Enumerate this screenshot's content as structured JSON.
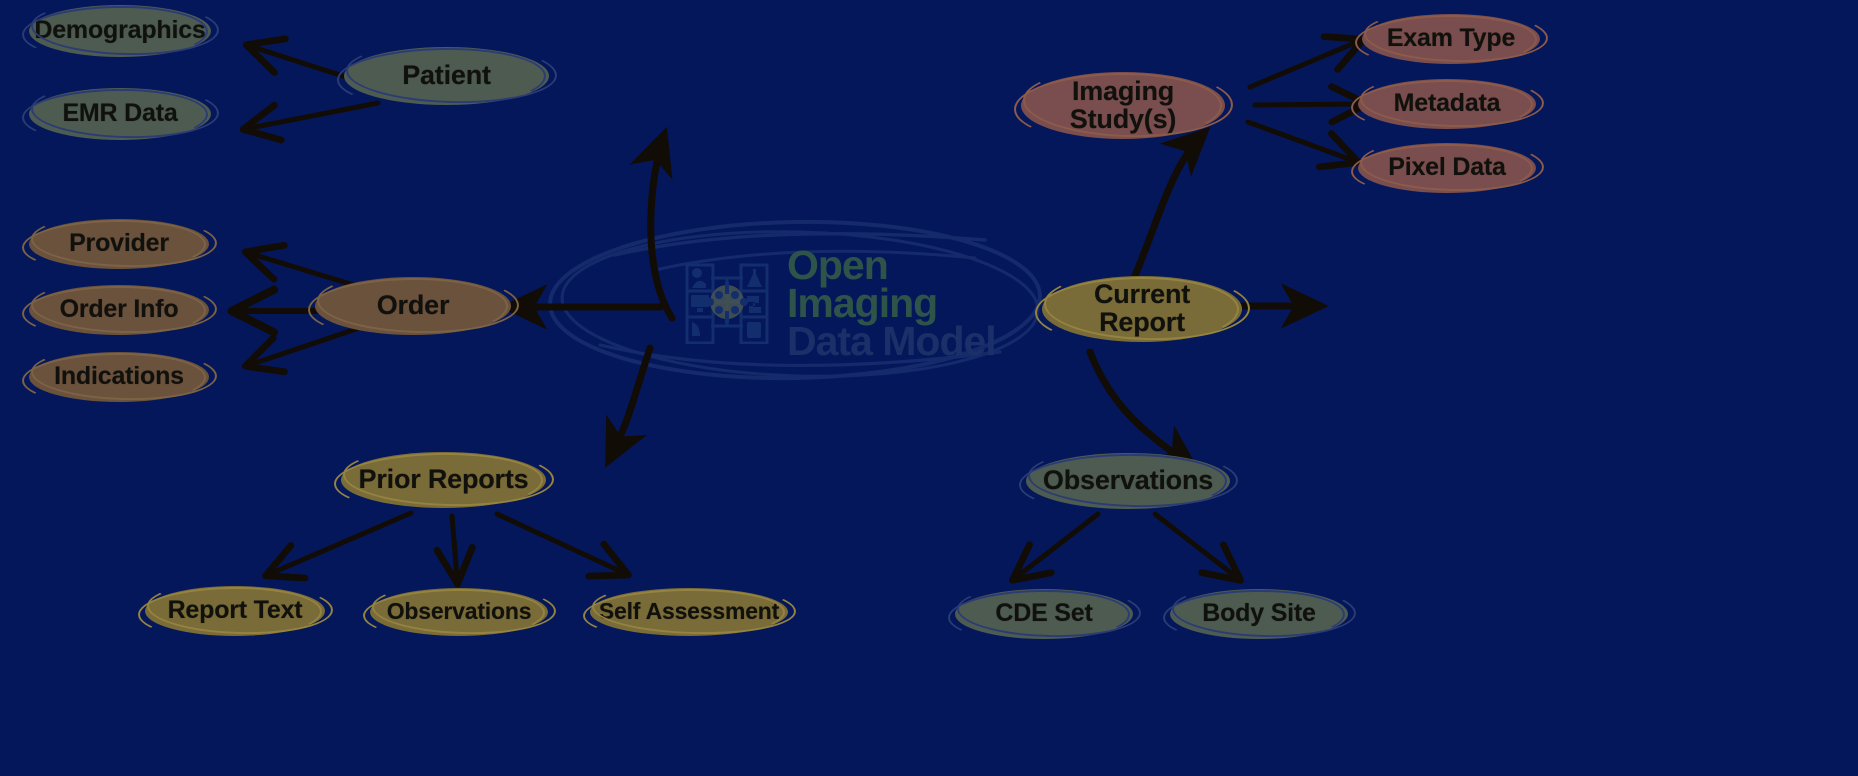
{
  "diagram": {
    "title": "Open Imaging Data Model",
    "background_color": "#04175a",
    "style": "hand-drawn mind map"
  },
  "center": {
    "name": "open-imaging-data-model-hub",
    "line1": "Open Imaging",
    "line2": "Data Model",
    "line1_color": "#2e5449",
    "line2_color": "#1b3069",
    "icon": "hub-and-spoke-data-nodes-icon"
  },
  "palette": {
    "sage": "#4d5b51",
    "brown": "#6b523d",
    "rose": "#7a4e4e",
    "olive": "#7a6c38",
    "arrow": "#120c06",
    "hub_outline": "#152a6b"
  },
  "branches": [
    {
      "id": "patient",
      "label": "Patient",
      "color_key": "sage",
      "children": [
        {
          "id": "demographics",
          "label": "Demographics",
          "color_key": "sage"
        },
        {
          "id": "emr-data",
          "label": "EMR Data",
          "color_key": "sage"
        }
      ]
    },
    {
      "id": "order",
      "label": "Order",
      "color_key": "brown",
      "children": [
        {
          "id": "provider",
          "label": "Provider",
          "color_key": "brown"
        },
        {
          "id": "order-info",
          "label": "Order Info",
          "color_key": "brown"
        },
        {
          "id": "indications",
          "label": "Indications",
          "color_key": "brown"
        }
      ]
    },
    {
      "id": "imaging-study",
      "label": "Imaging Study(s)",
      "label_line1": "Imaging",
      "label_line2": "Study(s)",
      "color_key": "rose",
      "children": [
        {
          "id": "exam-type",
          "label": "Exam Type",
          "color_key": "rose"
        },
        {
          "id": "metadata",
          "label": "Metadata",
          "color_key": "rose"
        },
        {
          "id": "pixel-data",
          "label": "Pixel Data",
          "color_key": "rose"
        }
      ]
    },
    {
      "id": "current-report",
      "label": "Current Report",
      "label_line1": "Current",
      "label_line2": "Report",
      "color_key": "olive",
      "children": []
    },
    {
      "id": "prior-reports",
      "label": "Prior Reports",
      "color_key": "olive",
      "children": [
        {
          "id": "report-text",
          "label": "Report Text",
          "color_key": "olive"
        },
        {
          "id": "prior-observations",
          "label": "Observations",
          "color_key": "olive"
        },
        {
          "id": "self-assessment",
          "label": "Self Assessment",
          "color_key": "olive"
        }
      ]
    },
    {
      "id": "observations",
      "label": "Observations",
      "color_key": "sage",
      "children": [
        {
          "id": "cde-set",
          "label": "CDE Set",
          "color_key": "sage"
        },
        {
          "id": "body-site",
          "label": "Body Site",
          "color_key": "sage"
        }
      ]
    }
  ]
}
